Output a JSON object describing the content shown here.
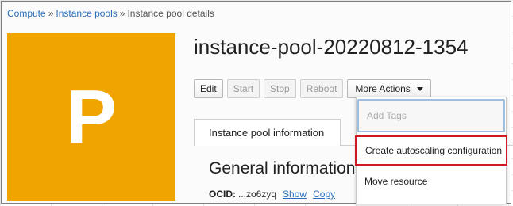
{
  "breadcrumb": {
    "items": [
      {
        "label": "Compute",
        "link": true
      },
      {
        "label": "Instance pools",
        "link": true
      },
      {
        "label": "Instance pool details",
        "link": false
      }
    ],
    "separator": "»"
  },
  "avatar": {
    "letter": "P",
    "color": "#f0a400"
  },
  "page_title": "instance-pool-20220812-1354",
  "toolbar": {
    "edit": "Edit",
    "start": "Start",
    "stop": "Stop",
    "reboot": "Reboot",
    "more_actions": "More Actions"
  },
  "tabs": {
    "active": "Instance pool information"
  },
  "section": {
    "title": "General information",
    "ocid_label": "OCID:",
    "ocid_value": "...zo6zyq",
    "show": "Show",
    "copy": "Copy"
  },
  "more_actions_menu": {
    "items": [
      {
        "label": "Add Tags",
        "disabled": true
      },
      {
        "label": "Create autoscaling configuration",
        "highlighted": true
      },
      {
        "label": "Move resource"
      }
    ]
  },
  "colors": {
    "link": "#2a6ebb",
    "highlight_border": "#d0191f",
    "avatar_bg": "#f0a400"
  }
}
